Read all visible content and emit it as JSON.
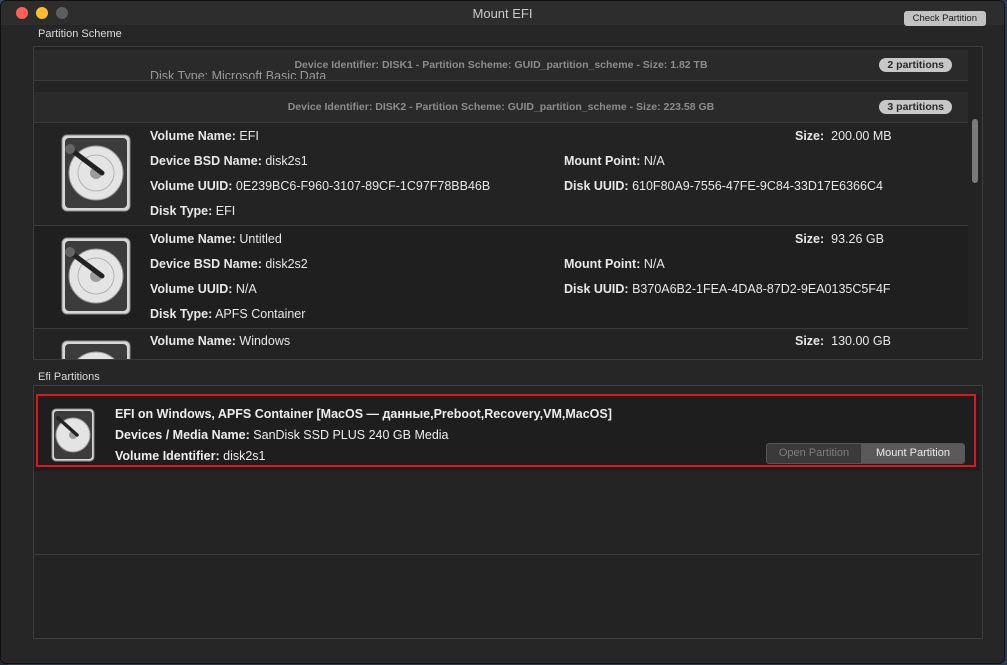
{
  "window": {
    "title": "Mount EFI",
    "check_button": "Check Partition"
  },
  "partition_scheme": {
    "label": "Partition Scheme",
    "groups": [
      {
        "header": "Device Identifier: DISK1 - Partition Scheme: GUID_partition_scheme - Size: 1.82 TB",
        "badge": "2 partitions",
        "partial_text": "Disk Type: Microsoft Basic Data"
      },
      {
        "header": "Device Identifier: DISK2 - Partition Scheme: GUID_partition_scheme - Size: 223.58 GB",
        "badge": "3 partitions",
        "volumes": [
          {
            "volume_name": "EFI",
            "size": "200.00 MB",
            "bsd_name": "disk2s1",
            "mount_point": "N/A",
            "volume_uuid": "0E239BC6-F960-3107-89CF-1C97F78BB46B",
            "disk_uuid": "610F80A9-7556-47FE-9C84-33D17E6366C4",
            "disk_type": "EFI"
          },
          {
            "volume_name": "Untitled",
            "size": "93.26 GB",
            "bsd_name": "disk2s2",
            "mount_point": "N/A",
            "volume_uuid": "N/A",
            "disk_uuid": "B370A6B2-1FEA-4DA8-87D2-9EA0135C5F4F",
            "disk_type": "APFS Container"
          },
          {
            "volume_name": "Windows",
            "size": "130.00 GB"
          }
        ]
      }
    ],
    "labels": {
      "volume_name": "Volume Name:",
      "size": "Size:",
      "bsd_name": "Device BSD Name:",
      "mount_point": "Mount Point:",
      "volume_uuid": "Volume UUID:",
      "disk_uuid": "Disk UUID:",
      "disk_type": "Disk Type:"
    }
  },
  "efi_partitions": {
    "label": "Efi Partitions",
    "items": [
      {
        "title": "EFI on Windows, APFS Container [MacOS — данные,Preboot,Recovery,VM,MacOS]",
        "media_label": "Devices / Media Name:",
        "media": "SanDisk SSD PLUS 240 GB Media",
        "volume_id_label": "Volume Identifier:",
        "volume_id": "disk2s1",
        "open_button": "Open Partition",
        "mount_button": "Mount Partition"
      }
    ]
  },
  "colors": {
    "selection_outline": "#e0151f",
    "window_bg": "#262626"
  }
}
